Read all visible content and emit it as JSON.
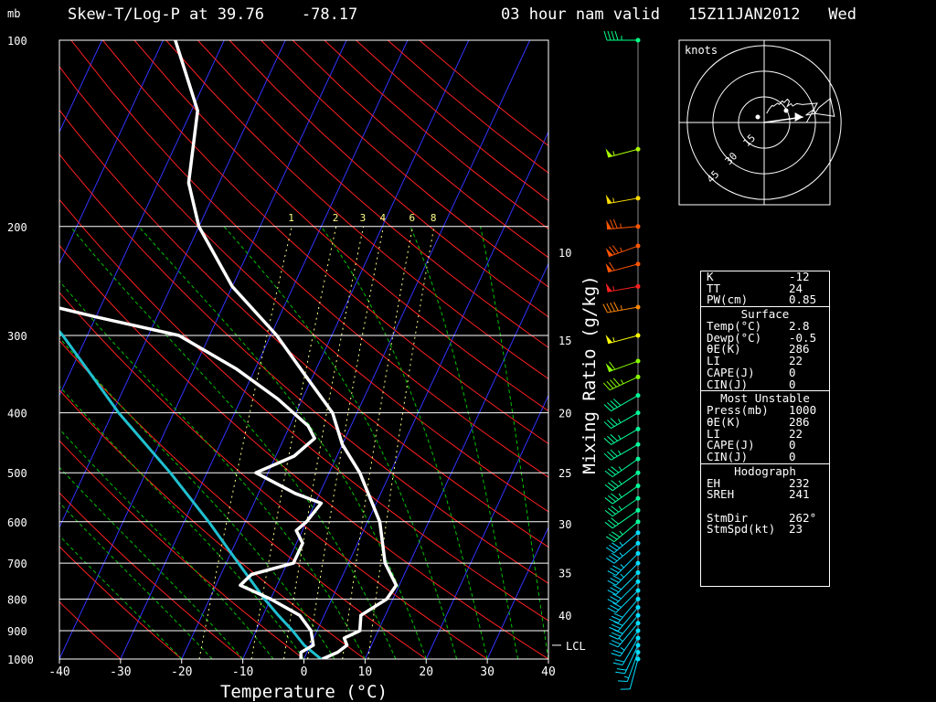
{
  "header": {
    "mb_label": "mb",
    "title": "Skew-T/Log-P at 39.76    -78.17",
    "valid": "03 hour nam valid   15Z11JAN2012   Wed"
  },
  "colors": {
    "background": "#000000",
    "isobar": "#ffffff",
    "isotherm": "#3333ff",
    "dry_adiabat": "#ff2020",
    "moist_adiabat": "#00c000",
    "mixing_ratio": "#ffff88",
    "temperature": "#ffffff",
    "dewpoint_bound": "#ffffff",
    "parcel": "#20c0d0"
  },
  "chart_data": {
    "type": "skew-t log-p",
    "pressure_axis_unit": "mb",
    "pressure_ticks": [
      100,
      200,
      300,
      400,
      500,
      600,
      700,
      800,
      900,
      1000
    ],
    "plim": [
      1000,
      100
    ],
    "xlabel": "Temperature (°C)",
    "x_ticks": [
      -40,
      -30,
      -20,
      -10,
      0,
      10,
      20,
      30,
      40
    ],
    "xlim": [
      -40,
      40
    ],
    "mixing_ratio_label": "Mixing Ratio (g/kg)",
    "mixing_ratio_lines": [
      1,
      2,
      3,
      4,
      6,
      8
    ],
    "right_axis_labels": [
      {
        "p": 220,
        "text": "10"
      },
      {
        "p": 305,
        "text": "15"
      },
      {
        "p": 400,
        "text": "20"
      },
      {
        "p": 500,
        "text": "25"
      },
      {
        "p": 605,
        "text": "30"
      },
      {
        "p": 725,
        "text": "35"
      },
      {
        "p": 850,
        "text": "40"
      }
    ],
    "lcl": {
      "p": 950,
      "label": "LCL"
    },
    "temperature_profile": [
      {
        "p": 1000,
        "t": 3
      },
      {
        "p": 975,
        "t": 5
      },
      {
        "p": 950,
        "t": 6
      },
      {
        "p": 925,
        "t": 5
      },
      {
        "p": 900,
        "t": 7
      },
      {
        "p": 850,
        "t": 6
      },
      {
        "p": 800,
        "t": 9
      },
      {
        "p": 760,
        "t": 9.5
      },
      {
        "p": 700,
        "t": 6
      },
      {
        "p": 600,
        "t": 2
      },
      {
        "p": 500,
        "t": -5
      },
      {
        "p": 450,
        "t": -10
      },
      {
        "p": 400,
        "t": -14
      },
      {
        "p": 350,
        "t": -21
      },
      {
        "p": 300,
        "t": -29
      },
      {
        "p": 250,
        "t": -40
      },
      {
        "p": 200,
        "t": -50
      },
      {
        "p": 170,
        "t": -55
      },
      {
        "p": 130,
        "t": -59
      },
      {
        "p": 100,
        "t": -68
      }
    ],
    "dewpoint_profile": [
      {
        "p": 1000,
        "t": -0.5
      },
      {
        "p": 975,
        "t": -1
      },
      {
        "p": 950,
        "t": 0.5
      },
      {
        "p": 900,
        "t": -1
      },
      {
        "p": 850,
        "t": -4
      },
      {
        "p": 800,
        "t": -10
      },
      {
        "p": 760,
        "t": -16
      },
      {
        "p": 730,
        "t": -15
      },
      {
        "p": 700,
        "t": -9
      },
      {
        "p": 650,
        "t": -9
      },
      {
        "p": 620,
        "t": -11
      },
      {
        "p": 600,
        "t": -10
      },
      {
        "p": 560,
        "t": -9
      },
      {
        "p": 540,
        "t": -14
      },
      {
        "p": 500,
        "t": -22
      },
      {
        "p": 470,
        "t": -17
      },
      {
        "p": 440,
        "t": -15
      },
      {
        "p": 420,
        "t": -17
      },
      {
        "p": 380,
        "t": -24
      },
      {
        "p": 340,
        "t": -33
      },
      {
        "p": 300,
        "t": -45
      },
      {
        "p": 280,
        "t": -60
      },
      {
        "p": 260,
        "t": -75
      }
    ],
    "parcel_profile": [
      {
        "p": 1000,
        "t": 2.8
      },
      {
        "p": 950,
        "t": -1
      },
      {
        "p": 900,
        "t": -4
      },
      {
        "p": 850,
        "t": -7.5
      },
      {
        "p": 800,
        "t": -11
      },
      {
        "p": 700,
        "t": -18
      },
      {
        "p": 600,
        "t": -26
      },
      {
        "p": 500,
        "t": -36
      },
      {
        "p": 400,
        "t": -49
      },
      {
        "p": 300,
        "t": -64
      },
      {
        "p": 245,
        "t": -76
      }
    ],
    "wind_barbs": [
      {
        "p": 100,
        "dir": 270,
        "spd": 45
      },
      {
        "p": 150,
        "dir": 255,
        "spd": 55
      },
      {
        "p": 180,
        "dir": 260,
        "spd": 55
      },
      {
        "p": 200,
        "dir": 265,
        "spd": 75
      },
      {
        "p": 215,
        "dir": 250,
        "spd": 75
      },
      {
        "p": 230,
        "dir": 255,
        "spd": 60
      },
      {
        "p": 250,
        "dir": 260,
        "spd": 55
      },
      {
        "p": 270,
        "dir": 260,
        "spd": 45
      },
      {
        "p": 300,
        "dir": 255,
        "spd": 55
      },
      {
        "p": 330,
        "dir": 250,
        "spd": 60
      },
      {
        "p": 350,
        "dir": 245,
        "spd": 45
      },
      {
        "p": 375,
        "dir": 240,
        "spd": 40
      },
      {
        "p": 400,
        "dir": 240,
        "spd": 35
      },
      {
        "p": 425,
        "dir": 240,
        "spd": 35
      },
      {
        "p": 450,
        "dir": 240,
        "spd": 35
      },
      {
        "p": 475,
        "dir": 235,
        "spd": 35
      },
      {
        "p": 500,
        "dir": 235,
        "spd": 35
      },
      {
        "p": 525,
        "dir": 235,
        "spd": 35
      },
      {
        "p": 550,
        "dir": 235,
        "spd": 35
      },
      {
        "p": 575,
        "dir": 235,
        "spd": 30
      },
      {
        "p": 600,
        "dir": 230,
        "spd": 35
      },
      {
        "p": 625,
        "dir": 230,
        "spd": 35
      },
      {
        "p": 650,
        "dir": 230,
        "spd": 35
      },
      {
        "p": 675,
        "dir": 225,
        "spd": 35
      },
      {
        "p": 700,
        "dir": 225,
        "spd": 35
      },
      {
        "p": 725,
        "dir": 225,
        "spd": 30
      },
      {
        "p": 750,
        "dir": 225,
        "spd": 30
      },
      {
        "p": 775,
        "dir": 225,
        "spd": 30
      },
      {
        "p": 800,
        "dir": 220,
        "spd": 30
      },
      {
        "p": 825,
        "dir": 220,
        "spd": 30
      },
      {
        "p": 850,
        "dir": 220,
        "spd": 30
      },
      {
        "p": 875,
        "dir": 220,
        "spd": 25
      },
      {
        "p": 900,
        "dir": 215,
        "spd": 25
      },
      {
        "p": 925,
        "dir": 210,
        "spd": 20
      },
      {
        "p": 950,
        "dir": 205,
        "spd": 20
      },
      {
        "p": 975,
        "dir": 200,
        "spd": 15
      },
      {
        "p": 1000,
        "dir": 195,
        "spd": 10
      }
    ],
    "hodograph": {
      "title": "knots",
      "ring_labels": [
        "15",
        "30",
        "45"
      ],
      "storm_motion": {
        "dir": 262,
        "spd": 23
      }
    }
  },
  "indices": {
    "top": [
      {
        "label": "K",
        "value": "-12"
      },
      {
        "label": "TT",
        "value": "24"
      },
      {
        "label": "PW(cm)",
        "value": "0.85"
      }
    ],
    "surface_title": "Surface",
    "surface": [
      {
        "label": "Temp(°C)",
        "value": "2.8"
      },
      {
        "label": "Dewp(°C)",
        "value": "-0.5"
      },
      {
        "label": "θE(K)",
        "value": "286"
      },
      {
        "label": "LI",
        "value": "22"
      },
      {
        "label": "CAPE(J)",
        "value": "0"
      },
      {
        "label": "CIN(J)",
        "value": "0"
      }
    ],
    "unstable_title": "Most Unstable",
    "unstable": [
      {
        "label": "Press(mb)",
        "value": "1000"
      },
      {
        "label": "θE(K)",
        "value": "286"
      },
      {
        "label": "LI",
        "value": "22"
      },
      {
        "label": "CAPE(J)",
        "value": "0"
      },
      {
        "label": "CIN(J)",
        "value": "0"
      }
    ],
    "hodo_title": "Hodograph",
    "hodo": [
      {
        "label": "EH",
        "value": "232"
      },
      {
        "label": "SREH",
        "value": "241"
      },
      {
        "label": "",
        "value": ""
      },
      {
        "label": "StmDir",
        "value": "262°"
      },
      {
        "label": "StmSpd(kt)",
        "value": "23"
      }
    ]
  }
}
